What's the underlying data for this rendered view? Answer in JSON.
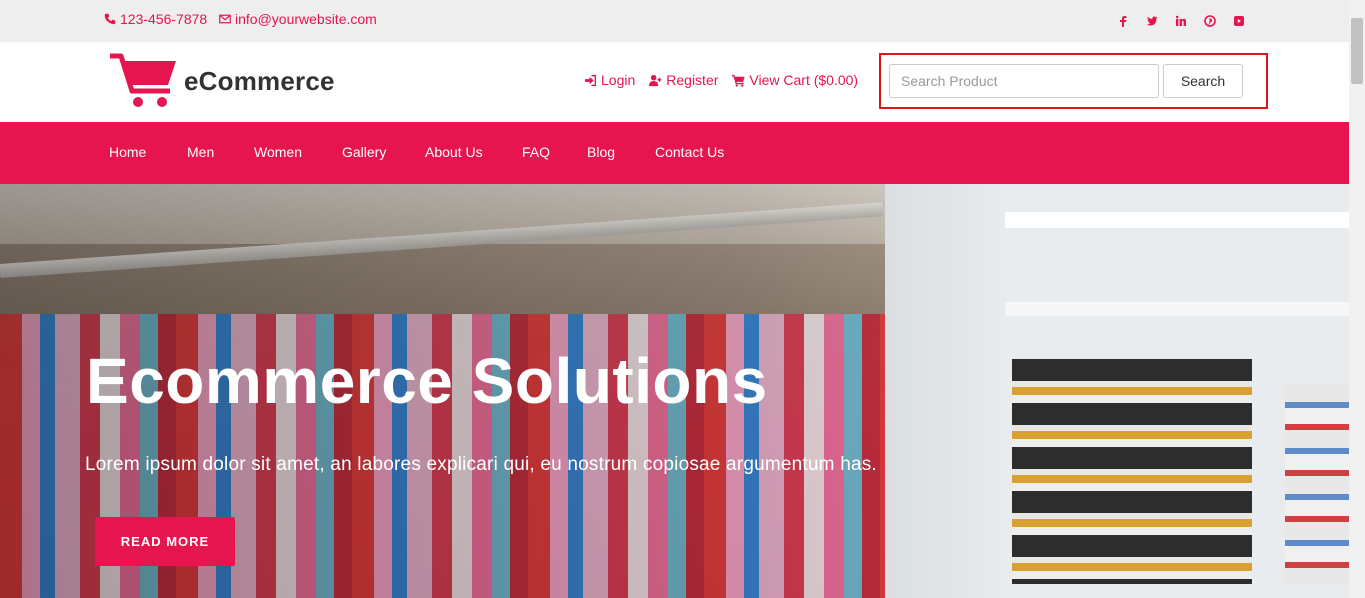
{
  "topbar": {
    "phone": "123-456-7878",
    "email": "info@yourwebsite.com",
    "socials": [
      {
        "icon": "facebook-icon",
        "glyph": "f"
      },
      {
        "icon": "twitter-icon",
        "glyph": "t"
      },
      {
        "icon": "linkedin-icon",
        "glyph": "in"
      },
      {
        "icon": "pinterest-icon",
        "glyph": "p"
      },
      {
        "icon": "youtube-icon",
        "glyph": "yt"
      }
    ]
  },
  "header": {
    "logo_text": "eCommerce",
    "links": {
      "login": "Login",
      "register": "Register",
      "cart": "View Cart ($0.00)"
    },
    "search": {
      "placeholder": "Search Product",
      "button": "Search"
    }
  },
  "nav": {
    "items": [
      "Home",
      "Men",
      "Women",
      "Gallery",
      "About Us",
      "FAQ",
      "Blog",
      "Contact Us"
    ]
  },
  "hero": {
    "title": "Ecommerce Solutions",
    "subtitle": "Lorem ipsum dolor sit amet, an labores explicari qui, eu nostrum copiosae argumentum has.",
    "button": "READ MORE"
  },
  "colors": {
    "brand": "#e6154f",
    "highlight_box": "#e0151a",
    "topbar_bg": "#eeeeee"
  }
}
